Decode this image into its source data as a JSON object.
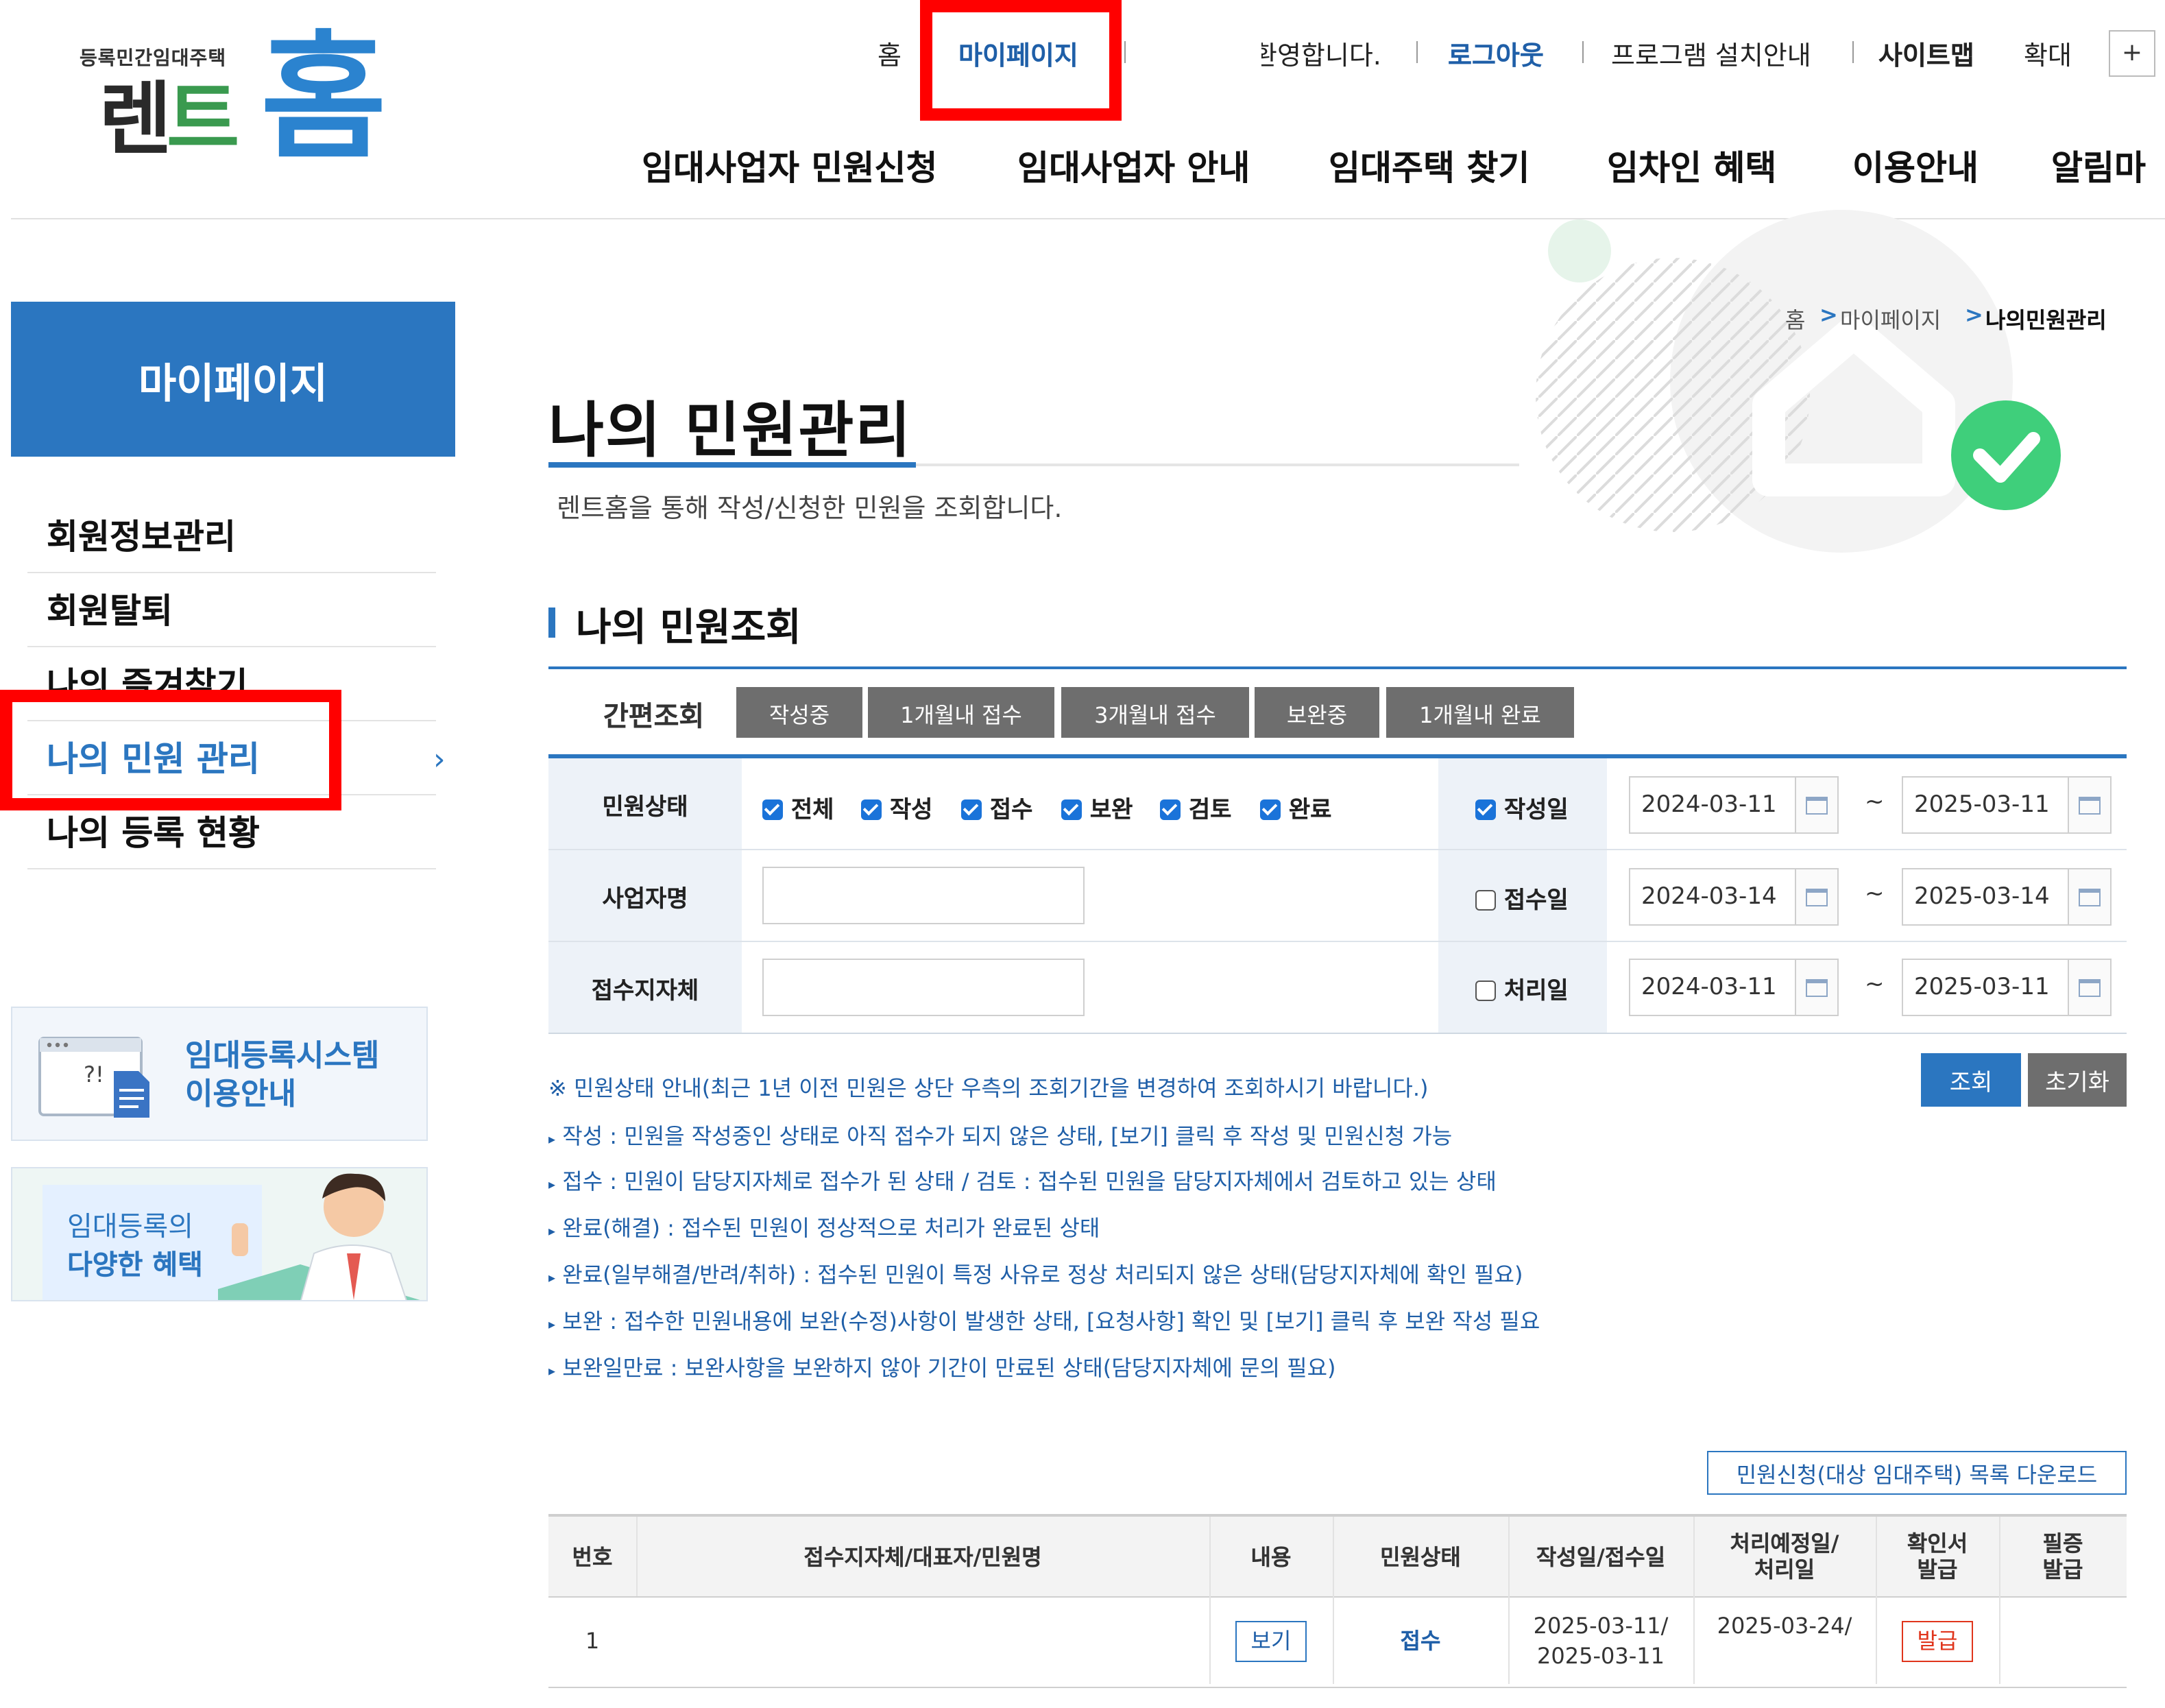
{
  "logo": {
    "small": "등록민간임대주택",
    "rent_a": "렌",
    "rent_b": "트",
    "home": "홈"
  },
  "util": {
    "home": "홈",
    "mypage": "마이페이지",
    "welcome": "환영합니다.",
    "logout": "로그아웃",
    "program": "프로그램 설치안내",
    "sitemap": "사이트맵",
    "zoom": "확대",
    "plus": "+"
  },
  "gnb": [
    "임대사업자 민원신청",
    "임대사업자 안내",
    "임대주택 찾기",
    "임차인 혜택",
    "이용안내",
    "알림마"
  ],
  "lnb": {
    "title": "마이페이지",
    "items": [
      "회원정보관리",
      "회원탈퇴",
      "나의 즐겨찾기",
      "나의 민원 관리",
      "나의 등록 현황"
    ]
  },
  "banners": {
    "system_line1": "임대등록시스템",
    "system_line2": "이용안내",
    "benefit_line1": "임대등록의",
    "benefit_line2": "다양한 혜택"
  },
  "breadcrumb": {
    "home": "홈",
    "mypage": "마이페이지",
    "current": "나의민원관리"
  },
  "page": {
    "title": "나의 민원관리",
    "desc": "렌트홈을 통해 작성/신청한 민원을 조회합니다.",
    "section": "나의 민원조회"
  },
  "quick": {
    "label": "간편조회",
    "buttons": [
      "작성중",
      "1개월내 접수",
      "3개월내 접수",
      "보완중",
      "1개월내 완료"
    ]
  },
  "form": {
    "status_label": "민원상태",
    "status_options": [
      {
        "label": "전체",
        "checked": true
      },
      {
        "label": "작성",
        "checked": true
      },
      {
        "label": "접수",
        "checked": true
      },
      {
        "label": "보완",
        "checked": true
      },
      {
        "label": "검토",
        "checked": true
      },
      {
        "label": "완료",
        "checked": true
      }
    ],
    "business_label": "사업자명",
    "business_value": "",
    "local_label": "접수지자체",
    "local_value": "",
    "date_rows": [
      {
        "label": "작성일",
        "checked": true,
        "from": "2024-03-11",
        "to": "2025-03-11"
      },
      {
        "label": "접수일",
        "checked": false,
        "from": "2024-03-14",
        "to": "2025-03-14"
      },
      {
        "label": "처리일",
        "checked": false,
        "from": "2024-03-11",
        "to": "2025-03-11"
      }
    ],
    "tilde": "~",
    "search": "조회",
    "reset": "초기화"
  },
  "notes": [
    "※ 민원상태 안내(최근 1년 이전 민원은 상단 우측의 조회기간을 변경하여 조회하시기 바랍니다.)",
    "작성 : 민원을 작성중인 상태로 아직 접수가 되지 않은 상태, [보기] 클릭 후 작성 및 민원신청 가능",
    "접수 : 민원이 담당지자체로 접수가 된 상태 / 검토 : 접수된 민원을 담당지자체에서 검토하고 있는 상태",
    "완료(해결) : 접수된 민원이 정상적으로 처리가 완료된 상태",
    "완료(일부해결/반려/취하) : 접수된 민원이 특정 사유로 정상 처리되지 않은 상태(담당지자체에 확인 필요)",
    "보완 : 접수한 민원내용에 보완(수정)사항이 발생한 상태, [요청사항] 확인 및 [보기] 클릭 후 보완 작성 필요",
    "보완일만료 : 보완사항을 보완하지 않아 기간이 만료된 상태(담당지자체에 문의 필요)"
  ],
  "download": "민원신청(대상 임대주택) 목록 다운로드",
  "table": {
    "headers": {
      "no": "번호",
      "org": "접수지자체/대표자/민원명",
      "content": "내용",
      "status": "민원상태",
      "date_l1": "작성일/접수일",
      "due_l1": "처리예정일/",
      "due_l2": "처리일",
      "cert_l1": "확인서",
      "cert_l2": "발급",
      "issue_l1": "필증",
      "issue_l2": "발급"
    },
    "rows": [
      {
        "no": "1",
        "org": "",
        "view": "보기",
        "status": "접수",
        "date_l1": "2025-03-11/",
        "date_l2": "2025-03-11",
        "due": "2025-03-24/",
        "cert": "발급"
      }
    ]
  }
}
